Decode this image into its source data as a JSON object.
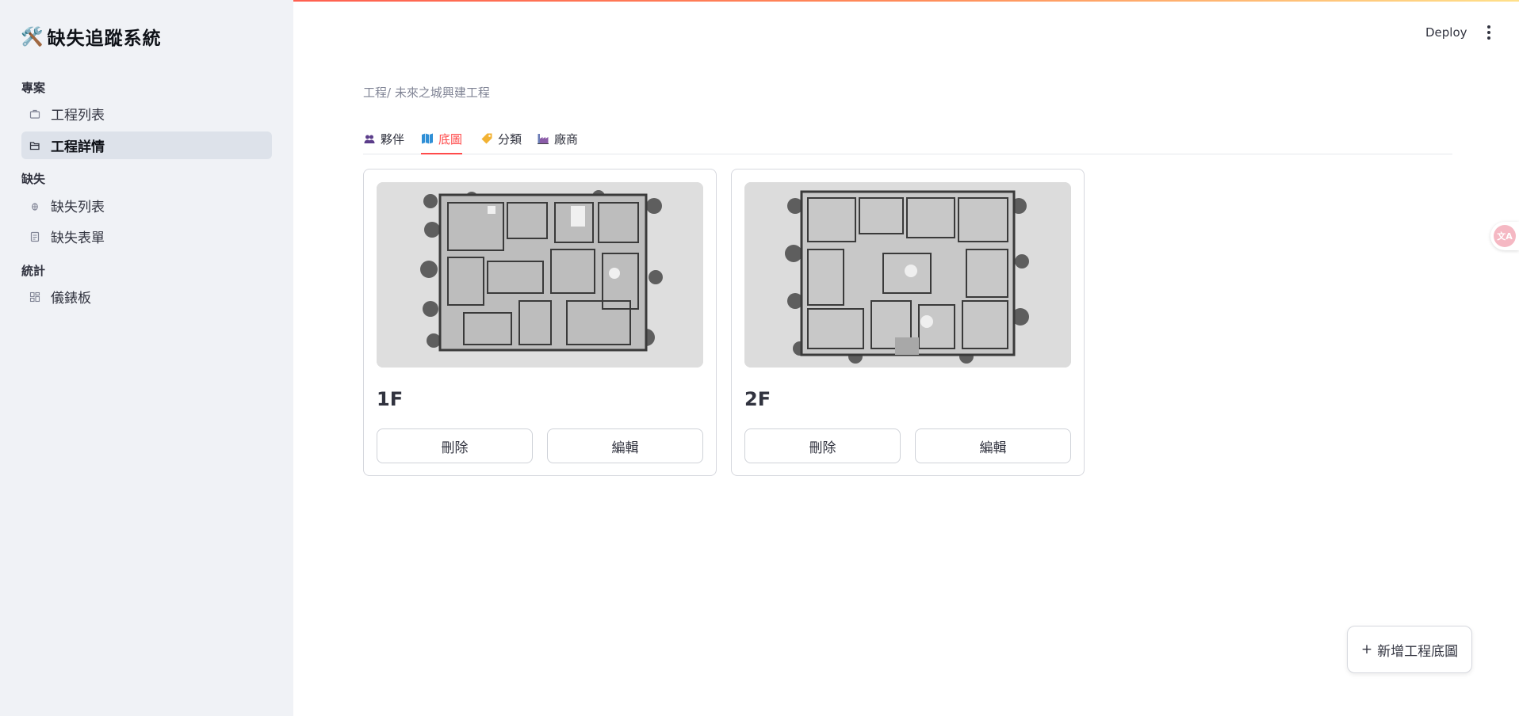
{
  "app": {
    "icon": "🛠️",
    "title": "缺失追蹤系統"
  },
  "header": {
    "deploy_label": "Deploy",
    "menu_icon": "kebab-menu-icon"
  },
  "sidebar": {
    "sections": [
      {
        "label": "專案",
        "items": [
          {
            "label": "工程列表",
            "icon": "briefcase-icon",
            "active": false
          },
          {
            "label": "工程詳情",
            "icon": "folder-open-icon",
            "active": true
          }
        ]
      },
      {
        "label": "缺失",
        "items": [
          {
            "label": "缺失列表",
            "icon": "bug-icon",
            "active": false
          },
          {
            "label": "缺失表單",
            "icon": "form-icon",
            "active": false
          }
        ]
      },
      {
        "label": "統計",
        "items": [
          {
            "label": "儀錶板",
            "icon": "dashboard-icon",
            "active": false
          }
        ]
      }
    ]
  },
  "breadcrumb": "工程/ 未來之城興建工程",
  "tabs": [
    {
      "label": "夥伴",
      "icon": "people-icon",
      "active": false
    },
    {
      "label": "底圖",
      "icon": "map-icon",
      "active": true
    },
    {
      "label": "分類",
      "icon": "tag-icon",
      "active": false
    },
    {
      "label": "廠商",
      "icon": "factory-icon",
      "active": false
    }
  ],
  "floor_plans": [
    {
      "title": "1F",
      "delete_label": "刪除",
      "edit_label": "編輯"
    },
    {
      "title": "2F",
      "delete_label": "刪除",
      "edit_label": "編輯"
    }
  ],
  "add_button": {
    "plus": "+",
    "label": "新增工程底圖"
  },
  "translate_badge": "文A"
}
